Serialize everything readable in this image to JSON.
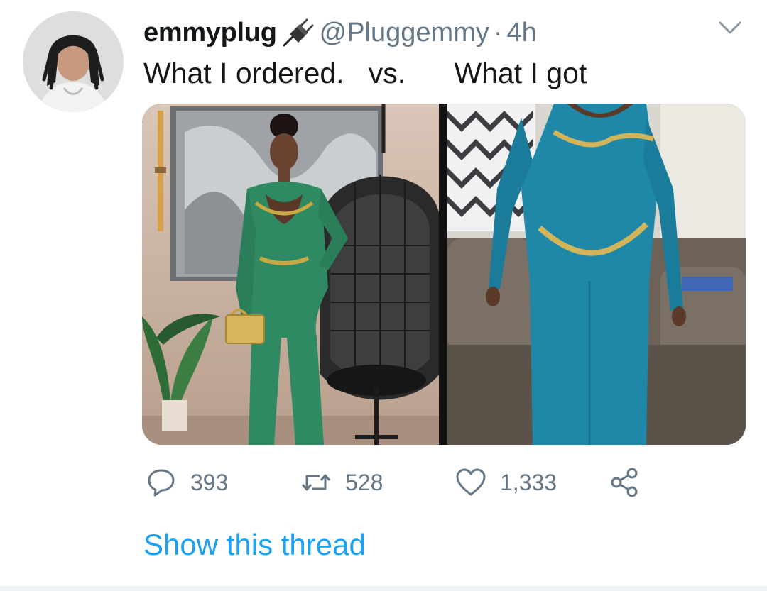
{
  "tweet": {
    "display_name": "emmyplug",
    "handle": "@Pluggemmy",
    "separator": "·",
    "time": "4h",
    "text": "What I ordered.   vs.      What I got",
    "icons": {
      "name_emoji": "electric-plug-icon",
      "menu": "chevron-down-icon",
      "reply": "reply-icon",
      "retweet": "retweet-icon",
      "like": "heart-icon",
      "share": "share-icon"
    },
    "stats": {
      "replies": "393",
      "retweets": "528",
      "likes": "1,333"
    },
    "show_thread": "Show this thread"
  },
  "colors": {
    "link": "#1da1f2",
    "secondary_text": "#657786",
    "primary_text": "#14171a"
  }
}
